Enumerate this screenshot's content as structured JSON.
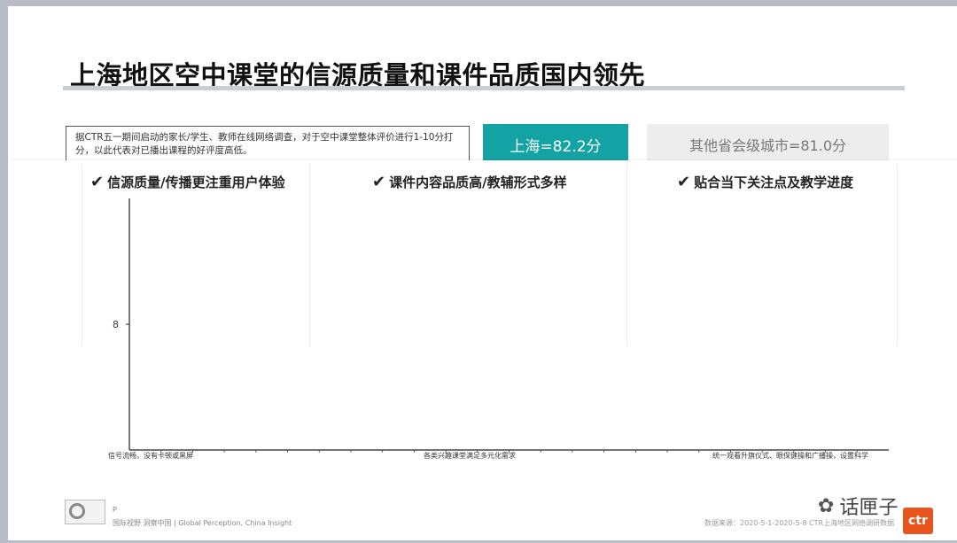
{
  "slide": {
    "title": "上海地区空中课堂的信源质量和课件品质国内领先",
    "survey_note": "据CTR五一期间启动的家长/学生、教师在线网络调查，对于空中课堂整体评价进行1-10分打分，以此代表对已播出课程的好评度高低。",
    "score_shanghai": "上海=82.2分",
    "score_other": "其他省会级城市=81.0分",
    "headings": [
      "信源质量/传播更注重用户体验",
      "课件内容品质高/教辅形式多样",
      "贴合当下关注点及教学进度"
    ],
    "check_glyph": "✔"
  },
  "chart_data": {
    "type": "bar",
    "categories": [
      "信号流畅，没有卡顿或黑屏",
      "各类兴趣课堂满足多元化需求",
      "统一观看升旗仪式、眼保健操和广播操，设置科学"
    ],
    "y_ticks": [
      "8"
    ],
    "series": []
  },
  "footer": {
    "p_mark": "P",
    "tagline": "国际视野  洞察中国 | Global Perception, China Insight",
    "source": "数据来源：2020-5-1-2020-5-8 CTR上海地区网络调研数据",
    "watermark": "话匣子",
    "ctr_logo": "ctr"
  },
  "colors": {
    "accent": "#14a3a5",
    "ctr_orange": "#e8541e"
  },
  "icons": {
    "wechat": "wechat-icon",
    "check": "check-icon"
  }
}
